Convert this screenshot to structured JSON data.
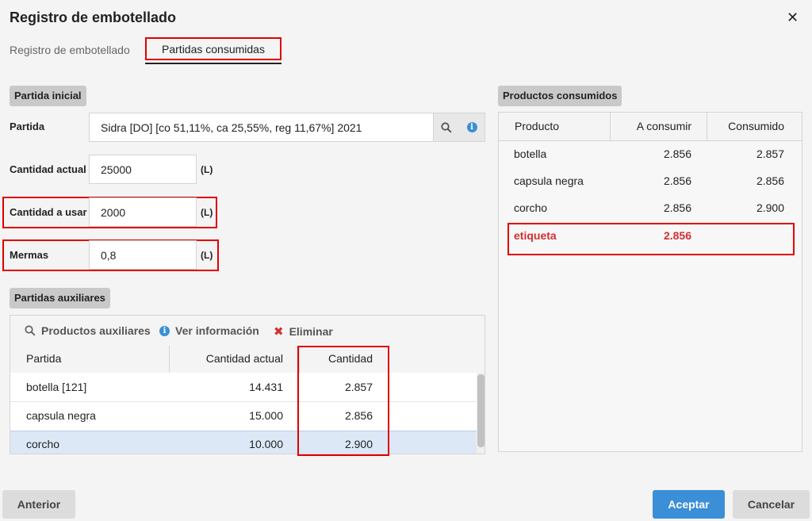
{
  "dialog": {
    "title": "Registro de embotellado",
    "close_icon": "close-icon"
  },
  "tabs": [
    {
      "label": "Registro de embotellado",
      "active": false
    },
    {
      "label": "Partidas consumidas",
      "active": true
    }
  ],
  "partida_inicial": {
    "header": "Partida inicial",
    "partida_label": "Partida",
    "partida_value": "Sidra [DO] [co 51,11%, ca 25,55%, reg 11,67%] 2021",
    "cantidad_actual_label": "Cantidad actual",
    "cantidad_actual_value": "25000",
    "cantidad_usar_label": "Cantidad a usar",
    "cantidad_usar_value": "2000",
    "mermas_label": "Mermas",
    "mermas_value": "0,8",
    "unit": "(L)"
  },
  "partidas_auxiliares": {
    "header": "Partidas auxiliares",
    "toolbar": {
      "productos": "Productos auxiliares",
      "ver_info": "Ver información",
      "eliminar": "Eliminar"
    },
    "columns": [
      "Partida",
      "Cantidad actual",
      "Cantidad"
    ],
    "rows": [
      {
        "partida": "botella [121]",
        "cantidad_actual": "14.431",
        "cantidad": "2.857"
      },
      {
        "partida": "capsula negra",
        "cantidad_actual": "15.000",
        "cantidad": "2.856"
      },
      {
        "partida": "corcho",
        "cantidad_actual": "10.000",
        "cantidad": "2.900"
      }
    ]
  },
  "productos_consumidos": {
    "header": "Productos consumidos",
    "columns": [
      "Producto",
      "A consumir",
      "Consumido"
    ],
    "rows": [
      {
        "producto": "botella",
        "a_consumir": "2.856",
        "consumido": "2.857"
      },
      {
        "producto": "capsula negra",
        "a_consumir": "2.856",
        "consumido": "2.856"
      },
      {
        "producto": "corcho",
        "a_consumir": "2.856",
        "consumido": "2.900"
      },
      {
        "producto": "etiqueta",
        "a_consumir": "2.856",
        "consumido": ""
      }
    ]
  },
  "footer": {
    "anterior": "Anterior",
    "aceptar": "Aceptar",
    "cancelar": "Cancelar"
  },
  "colors": {
    "accent": "#3a8fd6",
    "highlight_red": "#e00000",
    "missing_text": "#d32f2f",
    "selected_row": "#dde8f6"
  }
}
